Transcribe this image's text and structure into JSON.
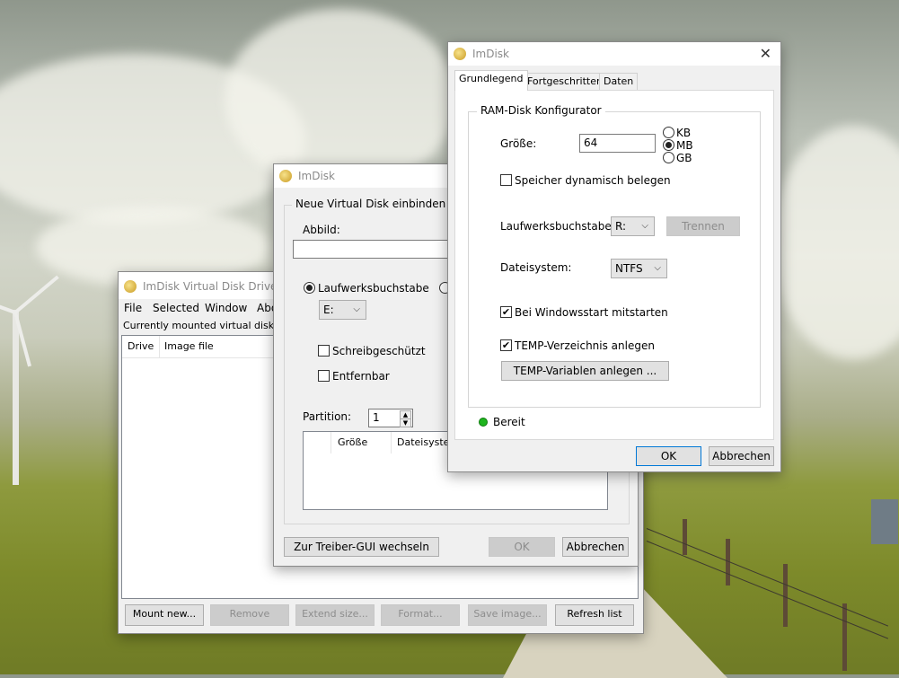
{
  "desktop": {
    "colors": {
      "sky": "#bfc3b8",
      "grass": "#7e8a2c"
    }
  },
  "driver_window": {
    "title": "ImDisk Virtual Disk Driver",
    "menu": [
      "File",
      "Selected",
      "Window",
      "Abo"
    ],
    "list_caption": "Currently mounted virtual disks",
    "columns": [
      "Drive",
      "Image file"
    ],
    "buttons": {
      "mount": "Mount new...",
      "remove": "Remove",
      "extend": "Extend size...",
      "format": "Format...",
      "save": "Save image...",
      "refresh": "Refresh list"
    }
  },
  "mount_window": {
    "title": "ImDisk",
    "group_title": "Neue Virtual Disk einbinden",
    "image_label": "Abbild:",
    "image_value": "",
    "drive_letter_label": "Laufwerksbuchstabe",
    "drive_letter_value": "E:",
    "readonly_label": "Schreibgeschützt",
    "removable_label": "Entfernbar",
    "partition_label": "Partition:",
    "partition_value": "1",
    "columns": [
      "Größe",
      "Dateisyste"
    ],
    "switch_button": "Zur Treiber-GUI wechseln",
    "ok_button": "OK",
    "cancel_button": "Abbrechen"
  },
  "ramdisk_window": {
    "title": "ImDisk",
    "tabs": [
      "Grundlegend",
      "Fortgeschritten",
      "Daten"
    ],
    "group_title": "RAM-Disk Konfigurator",
    "size_label": "Größe:",
    "size_value": "64",
    "units": [
      "KB",
      "MB",
      "GB"
    ],
    "selected_unit": "MB",
    "dynamic_label": "Speicher dynamisch belegen",
    "dynamic_checked": false,
    "drive_label": "Laufwerksbuchstabe:",
    "drive_value": "R:",
    "detach_button": "Trennen",
    "fs_label": "Dateisystem:",
    "fs_value": "NTFS",
    "autostart_label": "Bei Windowsstart mitstarten",
    "autostart_checked": true,
    "temp_label": "TEMP-Verzeichnis anlegen",
    "temp_checked": true,
    "temp_vars_button": "TEMP-Variablen anlegen ...",
    "status": "Bereit",
    "status_color": "#1eb41e",
    "ok_button": "OK",
    "cancel_button": "Abbrechen"
  }
}
